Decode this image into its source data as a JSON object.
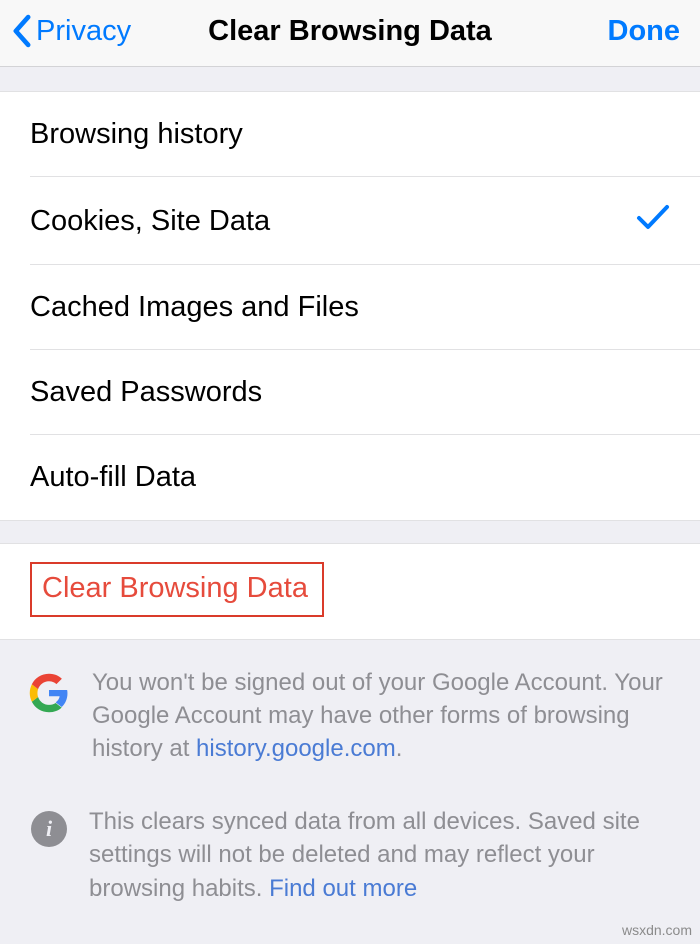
{
  "navbar": {
    "back_label": "Privacy",
    "title": "Clear Browsing Data",
    "done_label": "Done"
  },
  "options": [
    {
      "label": "Browsing history",
      "checked": false
    },
    {
      "label": "Cookies, Site Data",
      "checked": true
    },
    {
      "label": "Cached Images and Files",
      "checked": false
    },
    {
      "label": "Saved Passwords",
      "checked": false
    },
    {
      "label": "Auto-fill Data",
      "checked": false
    }
  ],
  "clear_button": "Clear Browsing Data",
  "footer": {
    "google_note_1": "You won't be signed out of your Google Account. Your Google Account may have other forms of browsing history at ",
    "google_link": "history.google.com",
    "google_note_2": ".",
    "sync_note_1": "This clears synced data from all devices. Saved site settings will not be deleted and may reflect your browsing habits. ",
    "sync_link": "Find out more"
  },
  "watermark": "wsxdn.com"
}
